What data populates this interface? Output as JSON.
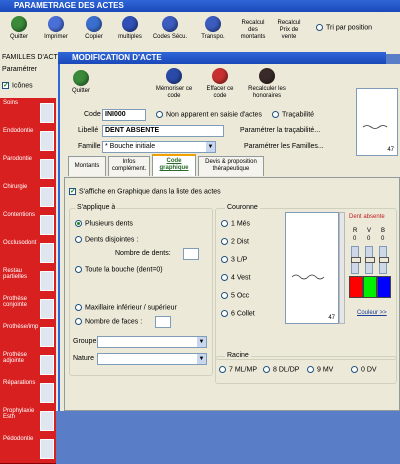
{
  "outer": {
    "title": "PARAMETRAGE DES ACTES",
    "toolbar": [
      "Quitter",
      "Imprimer",
      "Copier",
      "multiples",
      "Codes Sécu.",
      "Transpo."
    ],
    "recalc1": "Recalcul des montants",
    "recalc2": "Recalcul Prix de vente",
    "sort_label": "Tri par position",
    "families_title": "FAMILLES D'ACT",
    "parametrer": "Paramétrer",
    "icones": "Icônes",
    "side_items": [
      "Soins",
      "Endodontie",
      "Parodontie",
      "Chirurgie",
      "Contentions",
      "Occlusodont",
      "Restau partielles",
      "Prothèse conjointe",
      "Prothèse/imp",
      "Prothèse adjointe",
      "Réparations",
      "Prophylaxie Esth",
      "Pédodontie"
    ]
  },
  "dialog": {
    "title": "MODIFICATION D'ACTE",
    "buttons": {
      "quit": "Quitter",
      "memorize": "Mémoriser ce code",
      "delete": "Effacer ce code",
      "recalc": "Recalculer les honoraires"
    },
    "preview_number": "47",
    "code_label": "Code",
    "code_value": "INI000",
    "not_shown_label": "Non apparent en saisie d'actes",
    "traceability_label": "Traçabilité",
    "libelle_label": "Libellé",
    "libelle_value": "DENT ABSENTE",
    "param_traceability": "Paramétrer la traçabilité...",
    "famille_label": "Famille",
    "famille_value": "* Bouche initiale",
    "param_familles": "Paramétrer les Familles...",
    "tabs": [
      "Montants",
      "Infos complément.",
      "Code graphique",
      "Devis & proposition thérapeutique"
    ],
    "show_graph_label": "S'affiche en Graphique dans la liste des actes",
    "applies_title": "S'applique à",
    "applies": {
      "plusieurs": "Plusieurs dents",
      "disjointes": "Dents disjointes :",
      "nombre_dents": "Nombre de dents:",
      "toute": "Toute la bouche (dent=0)",
      "maxillaire": "Maxillaire inférieur / supérieur",
      "nombre_faces": "Nombre de faces :"
    },
    "groupe_label": "Groupe",
    "nature_label": "Nature",
    "couronne_title": "Couronne",
    "couronne": [
      "1 Més",
      "2 Dist",
      "3 L/P",
      "4 Vest",
      "5 Occ",
      "6 Collet"
    ],
    "graph_number": "47",
    "color_title": "Dent absente",
    "rvb": [
      "R",
      "V",
      "B"
    ],
    "rvb_values": [
      0,
      0,
      0
    ],
    "couleur_link": "Couleur >>",
    "racine_title": "Racine",
    "racine": [
      "7 ML/MP",
      "8 DL/DP",
      "9 MV",
      "0 DV"
    ],
    "colors": {
      "red": "#ff0000",
      "green": "#00ee00",
      "blue": "#0000ff",
      "accent": "#d92020"
    }
  }
}
